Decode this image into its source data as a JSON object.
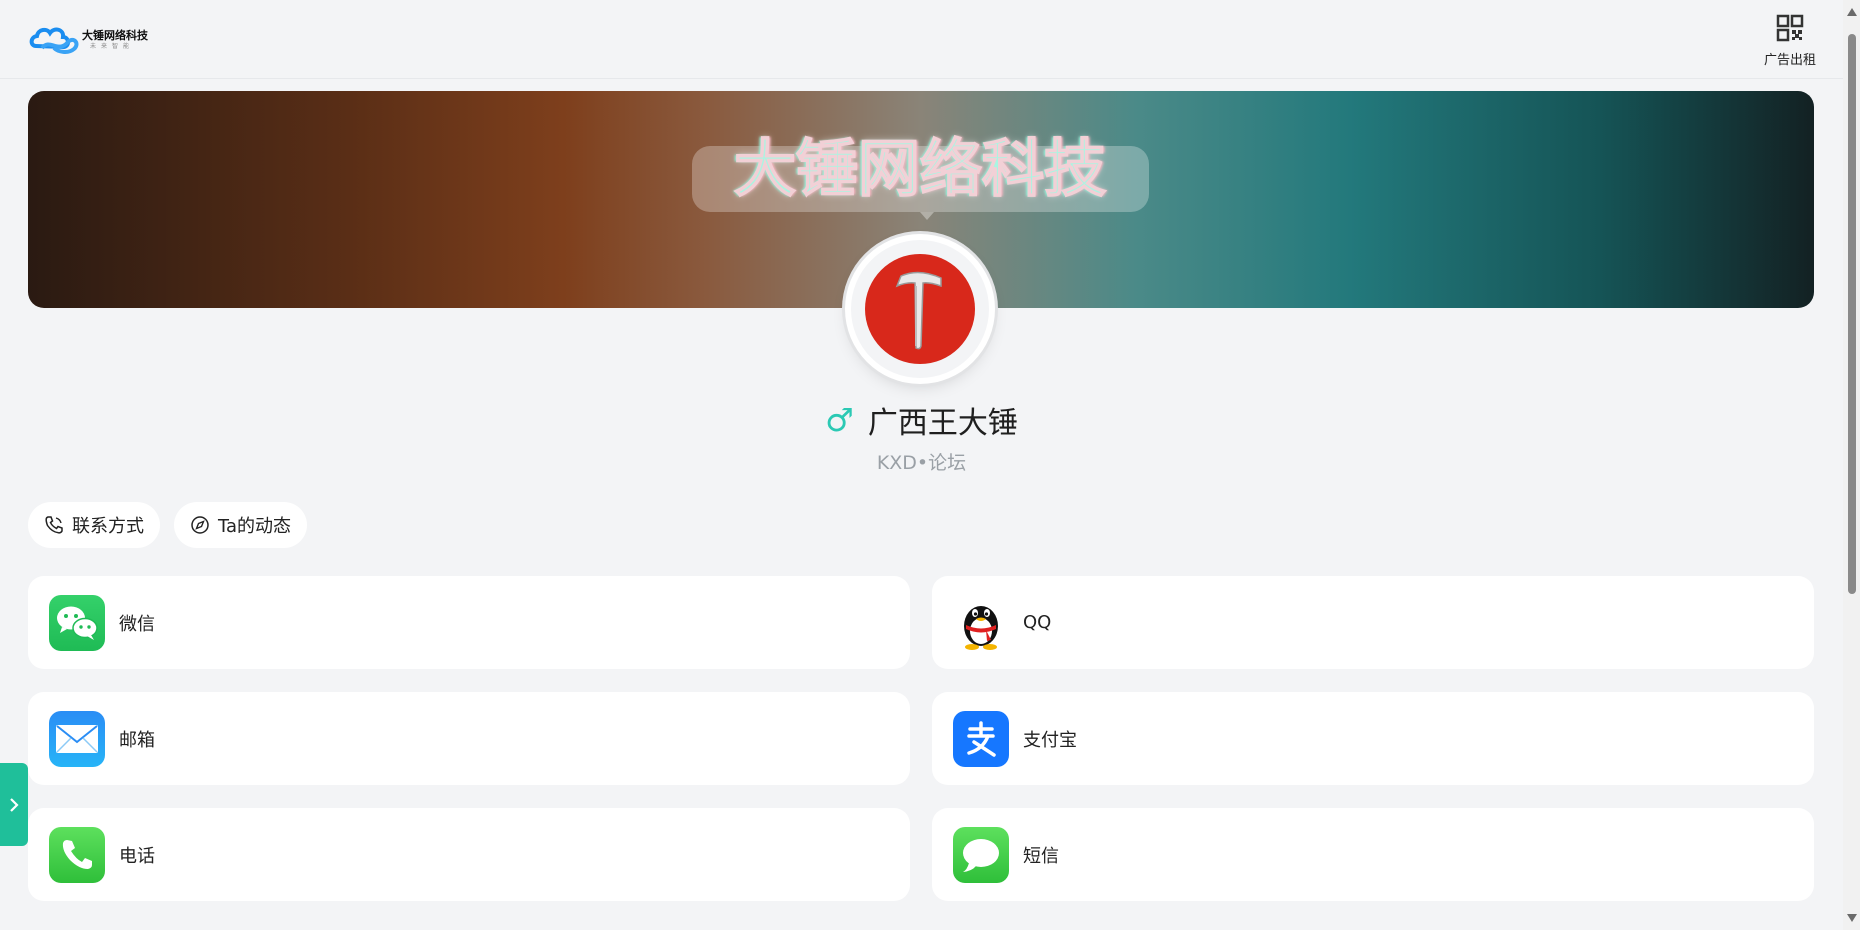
{
  "header": {
    "logo": {
      "title": "大锤网络科技",
      "subtitle": "未来智能"
    },
    "ad_rent_label": "广告出租"
  },
  "banner": {
    "title": "大锤网络科技"
  },
  "profile": {
    "gender_symbol": "♂",
    "name": "广西王大锤",
    "subtitle": "KXD•论坛"
  },
  "tabs": [
    {
      "label": "联系方式",
      "icon": "phone-icon"
    },
    {
      "label": "Ta的动态",
      "icon": "compass-icon"
    }
  ],
  "contacts": [
    {
      "label": "微信",
      "icon": "wechat-icon"
    },
    {
      "label": "QQ",
      "icon": "qq-icon"
    },
    {
      "label": "邮箱",
      "icon": "mail-icon"
    },
    {
      "label": "支付宝",
      "icon": "alipay-icon"
    },
    {
      "label": "电话",
      "icon": "phone-icon"
    },
    {
      "label": "短信",
      "icon": "sms-icon"
    }
  ],
  "colors": {
    "accent": "#1fbf9a",
    "gender": "#2bc9b4",
    "avatar_bg": "#d8281b",
    "page_bg": "#f3f4f6"
  }
}
